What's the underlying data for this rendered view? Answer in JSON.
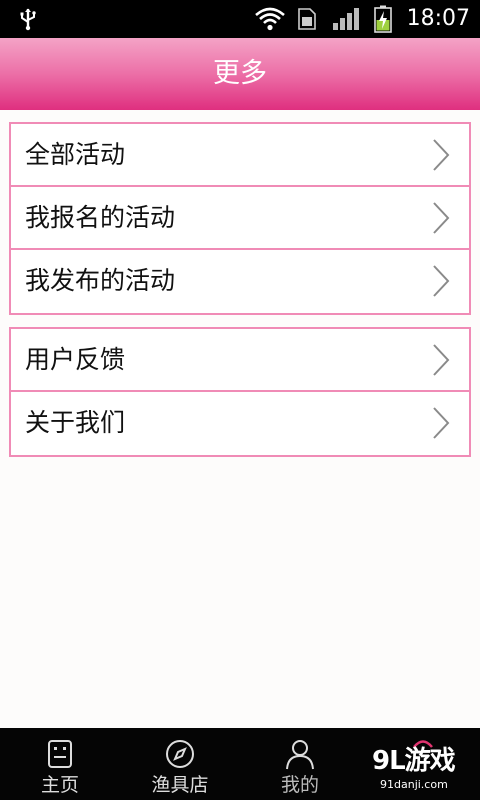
{
  "status_bar": {
    "time": "18:07",
    "icons": [
      "usb-icon",
      "wifi-icon",
      "sim-card-icon",
      "signal-icon",
      "battery-charging-icon"
    ]
  },
  "header": {
    "title": "更多",
    "gradient": [
      "#f4a3c6",
      "#ec6fa7",
      "#df2f7f"
    ]
  },
  "menu": {
    "border_color": "#f08bb6",
    "group1": [
      {
        "label": "全部活动",
        "icon": "chevron-right-icon"
      },
      {
        "label": "我报名的活动",
        "icon": "chevron-right-icon"
      },
      {
        "label": "我发布的活动",
        "icon": "chevron-right-icon"
      }
    ],
    "group2": [
      {
        "label": "用户反馈",
        "icon": "chevron-right-icon"
      },
      {
        "label": "关于我们",
        "icon": "chevron-right-icon"
      }
    ]
  },
  "tab_bar": {
    "tabs": [
      {
        "label": "主页",
        "icon": "home-icon"
      },
      {
        "label": "渔具店",
        "icon": "compass-icon"
      },
      {
        "label": "我的",
        "icon": "user-icon"
      }
    ]
  },
  "watermark": {
    "logo": "9L游戏",
    "url": "91danji.com"
  }
}
